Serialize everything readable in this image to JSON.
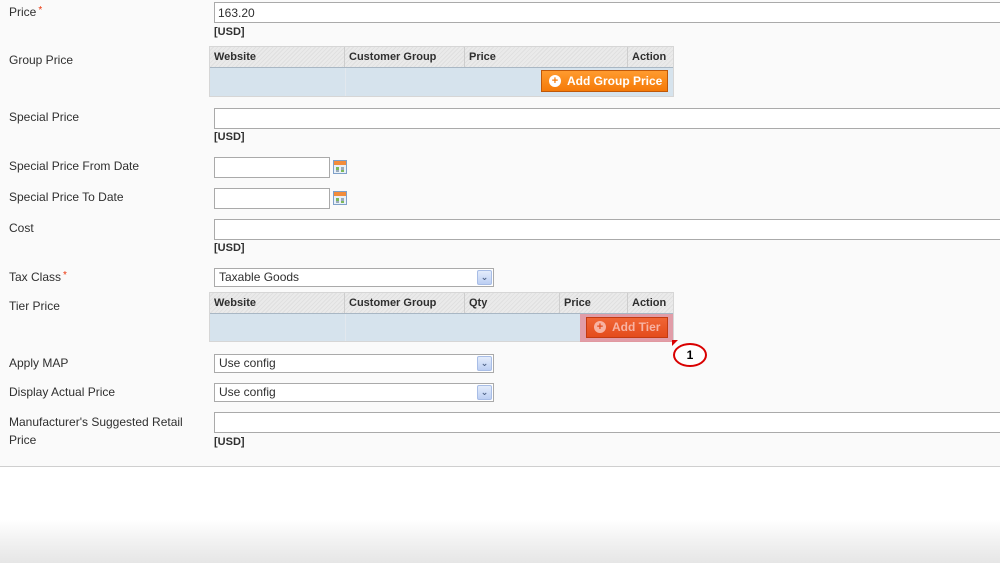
{
  "form": {
    "price": {
      "label": "Price",
      "required_mark": "*",
      "value": "163.20",
      "currency": "[USD]"
    },
    "group_price": {
      "label": "Group Price",
      "columns": [
        "Website",
        "Customer Group",
        "Price",
        "Action"
      ],
      "add_button": "Add Group Price"
    },
    "special_price": {
      "label": "Special Price",
      "value": "",
      "currency": "[USD]"
    },
    "special_from": {
      "label": "Special Price From Date",
      "value": "",
      "icon": "calendar-icon"
    },
    "special_to": {
      "label": "Special Price To Date",
      "value": "",
      "icon": "calendar-icon"
    },
    "cost": {
      "label": "Cost",
      "value": "",
      "currency": "[USD]"
    },
    "tax_class": {
      "label": "Tax Class",
      "required_mark": "*",
      "selected": "Taxable Goods"
    },
    "tier_price": {
      "label": "Tier Price",
      "columns": [
        "Website",
        "Customer Group",
        "Qty",
        "Price",
        "Action"
      ],
      "add_button": "Add Tier"
    },
    "apply_map": {
      "label": "Apply MAP",
      "selected": "Use config"
    },
    "display_actual": {
      "label": "Display Actual Price",
      "selected": "Use config"
    },
    "msrp": {
      "label_line1": "Manufacturer's Suggested Retail",
      "label_line2": "Price",
      "value": "",
      "currency": "[USD]"
    }
  },
  "annotation": {
    "callout_number": "1"
  },
  "colors": {
    "accent_orange": "#f57a08",
    "highlight_red": "#d90000",
    "grid_body": "#d6e3ed"
  }
}
